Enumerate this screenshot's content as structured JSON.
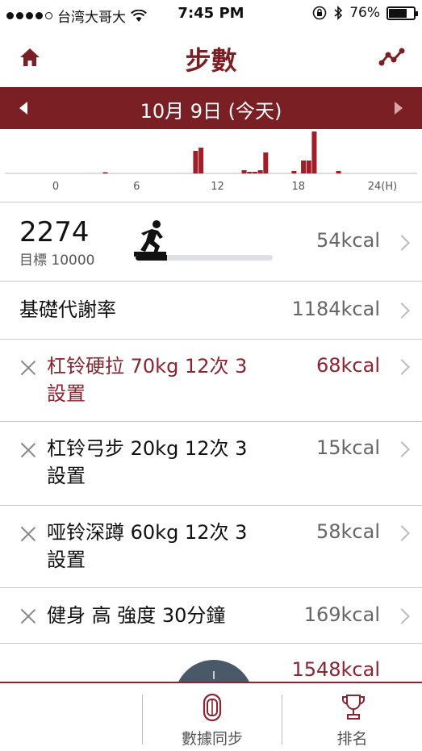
{
  "status": {
    "carrier": "台湾大哥大",
    "time": "7:45 PM",
    "battery_text": "76%",
    "battery_level": 0.76
  },
  "nav": {
    "title": "步數"
  },
  "date_bar": {
    "label": "10月 9日 (今天)"
  },
  "chart": {
    "x_ticks": [
      "0",
      "6",
      "12",
      "18",
      "24(H)"
    ],
    "bar_color": "#a01e28",
    "hourly_steps": [
      {
        "hour": 3.5,
        "value": 1
      },
      {
        "hour": 10.2,
        "value": 28
      },
      {
        "hour": 10.6,
        "value": 32
      },
      {
        "hour": 13.8,
        "value": 4
      },
      {
        "hour": 14.2,
        "value": 2
      },
      {
        "hour": 14.6,
        "value": 2
      },
      {
        "hour": 15.0,
        "value": 4
      },
      {
        "hour": 15.4,
        "value": 26
      },
      {
        "hour": 17.5,
        "value": 3
      },
      {
        "hour": 18.2,
        "value": 16
      },
      {
        "hour": 18.6,
        "value": 16
      },
      {
        "hour": 19.0,
        "value": 52
      },
      {
        "hour": 20.8,
        "value": 3
      }
    ]
  },
  "steps": {
    "count": "2274",
    "goal": "目標 10000",
    "kcal": "54kcal",
    "progress": 0.2274
  },
  "rows": [
    {
      "label": "基礎代謝率",
      "kcal": "1184kcal"
    },
    {
      "label_line1": "杠铃硬拉 70kg 12次 3",
      "label_line2": "設置",
      "kcal": "68kcal"
    },
    {
      "label_line1": "杠铃弓步 20kg 12次 3",
      "label_line2": "設置",
      "kcal": "15kcal"
    },
    {
      "label_line1": "哑铃深蹲 60kg 12次 3",
      "label_line2": "設置",
      "kcal": "58kcal"
    },
    {
      "label": "健身 高 強度 30分鐘",
      "kcal": "169kcal"
    }
  ],
  "total_kcal": "1548kcal",
  "tabs": [
    {
      "label": "數據同步",
      "icon": "sync-band-icon"
    },
    {
      "label": "排名",
      "icon": "trophy-icon"
    }
  ],
  "colors": {
    "accent": "#7a1f24",
    "highlight": "#8b2430"
  }
}
